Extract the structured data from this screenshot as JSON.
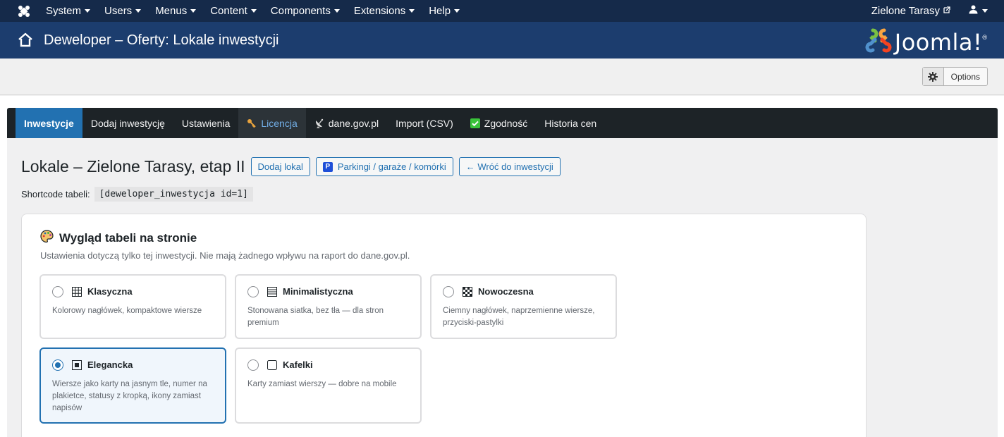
{
  "topbar": {
    "menu": [
      {
        "label": "System"
      },
      {
        "label": "Users"
      },
      {
        "label": "Menus"
      },
      {
        "label": "Content"
      },
      {
        "label": "Components"
      },
      {
        "label": "Extensions"
      },
      {
        "label": "Help"
      }
    ],
    "site_link": "Zielone Tarasy"
  },
  "header": {
    "title": "Deweloper – Oferty: Lokale inwestycji",
    "brand": "Joomla!"
  },
  "toolbar": {
    "options_label": "Options"
  },
  "tabs": [
    {
      "label": "Inwestycje",
      "state": "active"
    },
    {
      "label": "Dodaj inwestycję",
      "state": "normal"
    },
    {
      "label": "Ustawienia",
      "state": "normal"
    },
    {
      "label": "Licencja",
      "state": "dark",
      "icon": "key-icon"
    },
    {
      "label": "dane.gov.pl",
      "state": "normal",
      "icon": "satellite-icon"
    },
    {
      "label": "Import (CSV)",
      "state": "normal"
    },
    {
      "label": "Zgodność",
      "state": "normal",
      "icon": "check-icon"
    },
    {
      "label": "Historia cen",
      "state": "normal"
    }
  ],
  "page": {
    "heading": "Lokale – Zielone Tarasy, etap II",
    "buttons": {
      "add": "Dodaj lokal",
      "parking": "Parkingi / garaże / komórki",
      "parking_badge": "P",
      "back": "← Wróć do inwestycji"
    },
    "shortcode_label": "Shortcode tabeli:",
    "shortcode_value": "[deweloper_inwestycja id=1]"
  },
  "card": {
    "title": "Wygląd tabeli na stronie",
    "subtitle": "Ustawienia dotyczą tylko tej inwestycji. Nie mają żadnego wpływu na raport do dane.gov.pl.",
    "options": [
      {
        "name": "Klasyczna",
        "glyph": "▦",
        "desc": "Kolorowy nagłówek, kompaktowe wiersze",
        "selected": false
      },
      {
        "name": "Minimalistyczna",
        "glyph": "▤",
        "desc": "Stonowana siatka, bez tła — dla stron premium",
        "selected": false
      },
      {
        "name": "Nowoczesna",
        "glyph": "▩",
        "desc": "Ciemny nagłówek, naprzemienne wiersze, przyciski-pastylki",
        "selected": false
      },
      {
        "name": "Elegancka",
        "glyph": "▣",
        "desc": "Wiersze jako karty na jasnym tle, numer na plakietce, statusy z kropką, ikony zamiast napisów",
        "selected": true
      },
      {
        "name": "Kafelki",
        "glyph": "▢",
        "desc": "Karty zamiast wierszy — dobre na mobile",
        "selected": false
      }
    ]
  },
  "colors": {
    "topbar": "#152a4a",
    "header": "#1c3d6e",
    "tabs_bg": "#1d2327",
    "accent": "#2271b1"
  }
}
